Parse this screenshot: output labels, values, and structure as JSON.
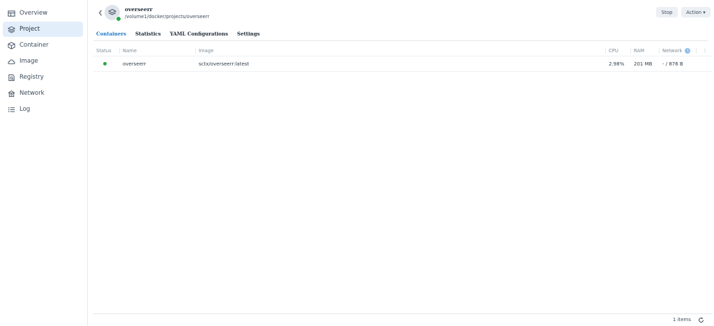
{
  "sidebar": {
    "items": [
      {
        "label": "Overview",
        "icon": "overview-icon"
      },
      {
        "label": "Project",
        "icon": "project-icon",
        "active": true
      },
      {
        "label": "Container",
        "icon": "container-icon"
      },
      {
        "label": "Image",
        "icon": "image-cloud-icon"
      },
      {
        "label": "Registry",
        "icon": "registry-icon"
      },
      {
        "label": "Network",
        "icon": "network-icon"
      },
      {
        "label": "Log",
        "icon": "log-icon"
      }
    ]
  },
  "header": {
    "title": "overseerr",
    "path": "/volume1/docker/projects/overseerr",
    "status_color": "#27a745",
    "stop_label": "Stop",
    "action_label": "Action ▾"
  },
  "tabs": [
    {
      "label": "Containers",
      "active": true
    },
    {
      "label": "Statistics"
    },
    {
      "label": "YAML Configurations"
    },
    {
      "label": "Settings"
    }
  ],
  "table": {
    "headers": {
      "status": "Status",
      "name": "Name",
      "image": "Image",
      "cpu": "CPU",
      "ram": "RAM",
      "network": "Network",
      "more": "⋮"
    },
    "rows": [
      {
        "status": "running",
        "name": "overseerr",
        "image": "sctx/overseerr:latest",
        "cpu": "2.98%",
        "ram": "201 MB",
        "network": "- / 876 B"
      }
    ]
  },
  "footer": {
    "count": "1 items"
  },
  "colors": {
    "accent": "#1f7ac9",
    "active_bg": "#e3eefb",
    "running": "#27a745"
  }
}
